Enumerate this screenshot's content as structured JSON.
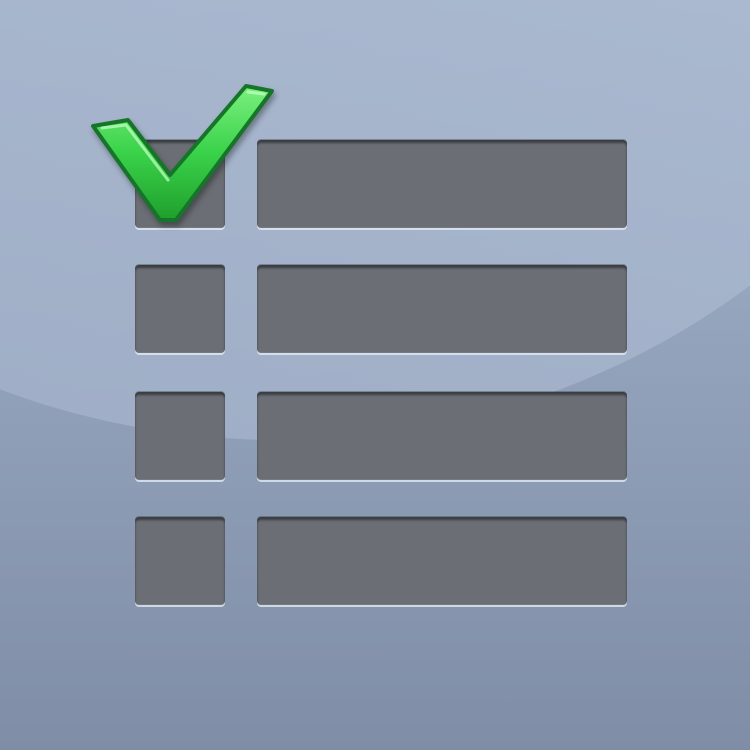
{
  "icon": {
    "name": "checklist-icon",
    "background_colors": [
      "#a5b5cc",
      "#93a3bb",
      "#7f8ea6"
    ],
    "slot_color": "#6b6f75",
    "check_color": "#3ad24a",
    "rows": [
      {
        "checked": true
      },
      {
        "checked": false
      },
      {
        "checked": false
      },
      {
        "checked": false
      }
    ]
  }
}
